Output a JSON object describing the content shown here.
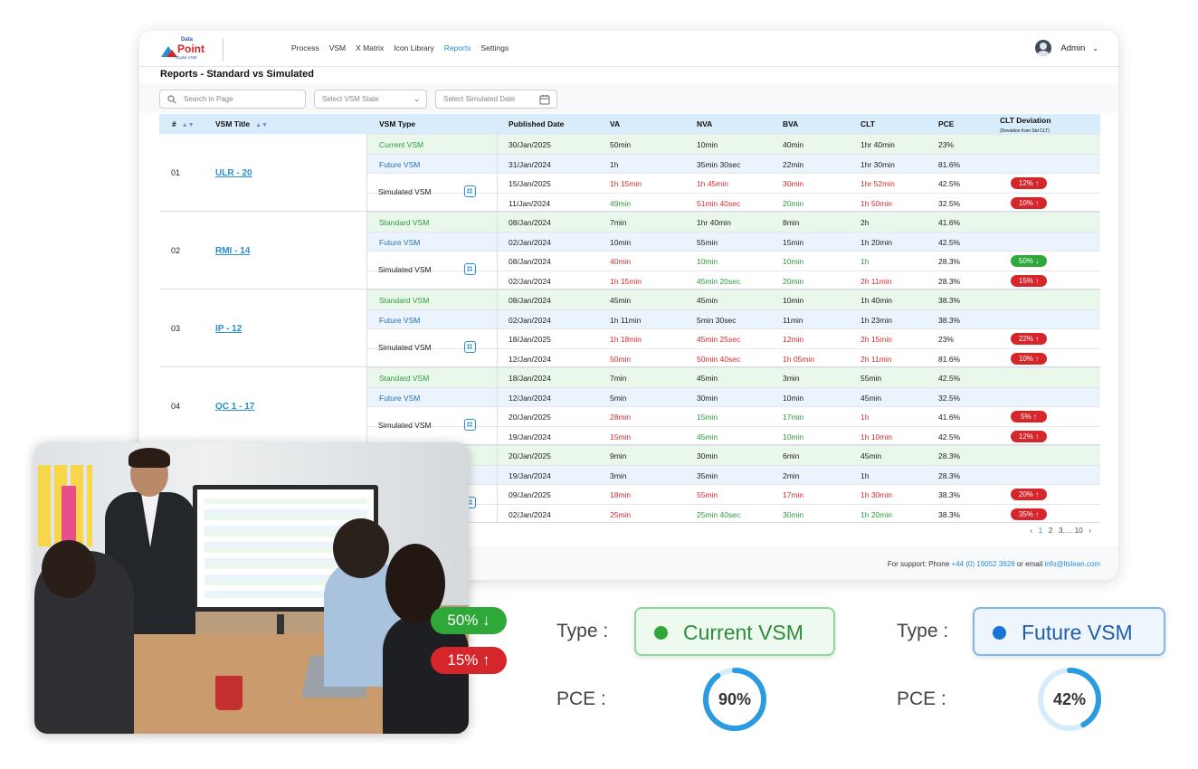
{
  "app": {
    "logo_top": "Data",
    "logo_main": "Point",
    "logo_sub": "Digital VSM",
    "admin": "Admin"
  },
  "nav": [
    "Process",
    "VSM",
    "X Matrix",
    "Icon Library",
    "Reports",
    "Settings"
  ],
  "page_title": "Reports - Standard vs Simulated",
  "filters": {
    "search_placeholder": "Search in Page",
    "state_placeholder": "Select VSM State",
    "date_placeholder": "Select Simulated Date"
  },
  "columns": {
    "idx": "#",
    "title": "VSM Title",
    "type": "VSM Type",
    "date": "Published Date",
    "va": "VA",
    "nva": "NVA",
    "bva": "BVA",
    "clt": "CLT",
    "pce": "PCE",
    "dev": "CLT Deviation",
    "dev_sub": "(Deviation from Std CLT)"
  },
  "simulated_label": "Simulated VSM",
  "groups": [
    {
      "idx": "01",
      "title": "ULR - 20",
      "rows": [
        {
          "type": "Current VSM",
          "tc": "green",
          "date": "30/Jan/2025",
          "va": "50min",
          "nva": "10min",
          "bva": "40min",
          "clt": "1hr 40min",
          "pce": "23%",
          "c": ""
        },
        {
          "type": "Future VSM",
          "tc": "blue",
          "date": "31/Jan/2024",
          "va": "1h",
          "nva": "35min 30sec",
          "bva": "22min",
          "clt": "1hr 30min",
          "pce": "81.6%",
          "c": ""
        },
        {
          "type": "",
          "tc": "",
          "date": "15/Jan/2025",
          "va": "1h 15min",
          "nva": "1h 45min",
          "bva": "30min",
          "clt": "1hr 52min",
          "pce": "42.5%",
          "c": "red",
          "badge": "12% ↑",
          "bc": "red"
        },
        {
          "type": "",
          "tc": "",
          "date": "11/Jan/2024",
          "va": "49min",
          "nva": "51min 40sec",
          "bva": "20min",
          "clt": "1h 50min",
          "pce": "32.5%",
          "c": "mix1",
          "badge": "10% ↑",
          "bc": "red"
        }
      ]
    },
    {
      "idx": "02",
      "title": "RMI - 14",
      "rows": [
        {
          "type": "Standard VSM",
          "tc": "green",
          "date": "08/Jan/2024",
          "va": "7min",
          "nva": "1hr 40min",
          "bva": "8min",
          "clt": "2h",
          "pce": "41.6%",
          "c": ""
        },
        {
          "type": "Future VSM",
          "tc": "blue",
          "date": "02/Jan/2024",
          "va": "10min",
          "nva": "55min",
          "bva": "15min",
          "clt": "1h 20min",
          "pce": "42.5%",
          "c": ""
        },
        {
          "type": "",
          "tc": "",
          "date": "08/Jan/2024",
          "va": "40min",
          "nva": "10min",
          "bva": "10min",
          "clt": "1h",
          "pce": "28.3%",
          "c": "mix2",
          "badge": "50% ↓",
          "bc": "grn"
        },
        {
          "type": "",
          "tc": "",
          "date": "02/Jan/2024",
          "va": "1h 15min",
          "nva": "45min 20sec",
          "bva": "20min",
          "clt": "2h 11min",
          "pce": "28.3%",
          "c": "mix3",
          "badge": "15% ↑",
          "bc": "red"
        }
      ]
    },
    {
      "idx": "03",
      "title": "IP - 12",
      "rows": [
        {
          "type": "Standard VSM",
          "tc": "green",
          "date": "08/Jan/2024",
          "va": "45min",
          "nva": "45min",
          "bva": "10min",
          "clt": "1h 40min",
          "pce": "38.3%",
          "c": ""
        },
        {
          "type": "Future VSM",
          "tc": "blue",
          "date": "02/Jan/2024",
          "va": "1h 11min",
          "nva": "5min 30sec",
          "bva": "11min",
          "clt": "1h 23min",
          "pce": "38.3%",
          "c": ""
        },
        {
          "type": "",
          "tc": "",
          "date": "18/Jan/2025",
          "va": "1h 18min",
          "nva": "45min 25sec",
          "bva": "12min",
          "clt": "2h 15min",
          "pce": "23%",
          "c": "red",
          "badge": "22% ↑",
          "bc": "red"
        },
        {
          "type": "",
          "tc": "",
          "date": "12/Jan/2024",
          "va": "50min",
          "nva": "50min 40sec",
          "bva": "1h 05min",
          "clt": "2h 11min",
          "pce": "81.6%",
          "c": "red",
          "badge": "10% ↑",
          "bc": "red"
        }
      ]
    },
    {
      "idx": "04",
      "title": "QC 1 - 17",
      "rows": [
        {
          "type": "Standard VSM",
          "tc": "green",
          "date": "18/Jan/2024",
          "va": "7min",
          "nva": "45min",
          "bva": "3min",
          "clt": "55min",
          "pce": "42.5%",
          "c": ""
        },
        {
          "type": "Future VSM",
          "tc": "blue",
          "date": "12/Jan/2024",
          "va": "5min",
          "nva": "30min",
          "bva": "10min",
          "clt": "45min",
          "pce": "32.5%",
          "c": ""
        },
        {
          "type": "",
          "tc": "",
          "date": "20/Jan/2025",
          "va": "28min",
          "nva": "15min",
          "bva": "17min",
          "clt": "1h",
          "pce": "41.6%",
          "c": "mix4",
          "badge": "5%  ↑",
          "bc": "red"
        },
        {
          "type": "",
          "tc": "",
          "date": "19/Jan/2024",
          "va": "15min",
          "nva": "45min",
          "bva": "10min",
          "clt": "1h 10min",
          "pce": "42.5%",
          "c": "mix5",
          "badge": "12% ↑",
          "bc": "red"
        }
      ]
    },
    {
      "idx": "",
      "title": "",
      "rows": [
        {
          "type": "",
          "tc": "green",
          "date": "20/Jan/2025",
          "va": "9min",
          "nva": "30min",
          "bva": "6min",
          "clt": "45min",
          "pce": "28.3%",
          "c": ""
        },
        {
          "type": "",
          "tc": "blue",
          "date": "19/Jan/2024",
          "va": "3min",
          "nva": "35min",
          "bva": "2min",
          "clt": "1h",
          "pce": "28.3%",
          "c": ""
        },
        {
          "type": "",
          "tc": "",
          "date": "09/Jan/2025",
          "va": "18min",
          "nva": "55min",
          "bva": "17min",
          "clt": "1h 30min",
          "pce": "38.3%",
          "c": "red",
          "badge": "20% ↑",
          "bc": "red"
        },
        {
          "type": "",
          "tc": "",
          "date": "02/Jan/2024",
          "va": "25min",
          "nva": "25min 40sec",
          "bva": "30min",
          "clt": "1h 20min",
          "pce": "38.3%",
          "c": "mix6",
          "badge": "35% ↑",
          "bc": "red"
        }
      ]
    }
  ],
  "pager": {
    "prev": "‹",
    "p1": "1",
    "p2": "2",
    "p3": "3",
    "dots": ".....",
    "p10": "10",
    "next": "›"
  },
  "footer": {
    "pre": "For support: Phone ",
    "phone": "+44 (0) 19052 3928",
    "mid": " or email ",
    "email": "info@ltslean.com"
  },
  "callouts": {
    "pill_green": "50% ↓",
    "pill_red": "15% ↑",
    "type_label": "Type :",
    "pce_label": "PCE :",
    "current": "Current VSM",
    "future": "Future VSM",
    "pce_current": "90%",
    "pce_future": "42%",
    "pce_current_value": 90,
    "pce_future_value": 42
  }
}
